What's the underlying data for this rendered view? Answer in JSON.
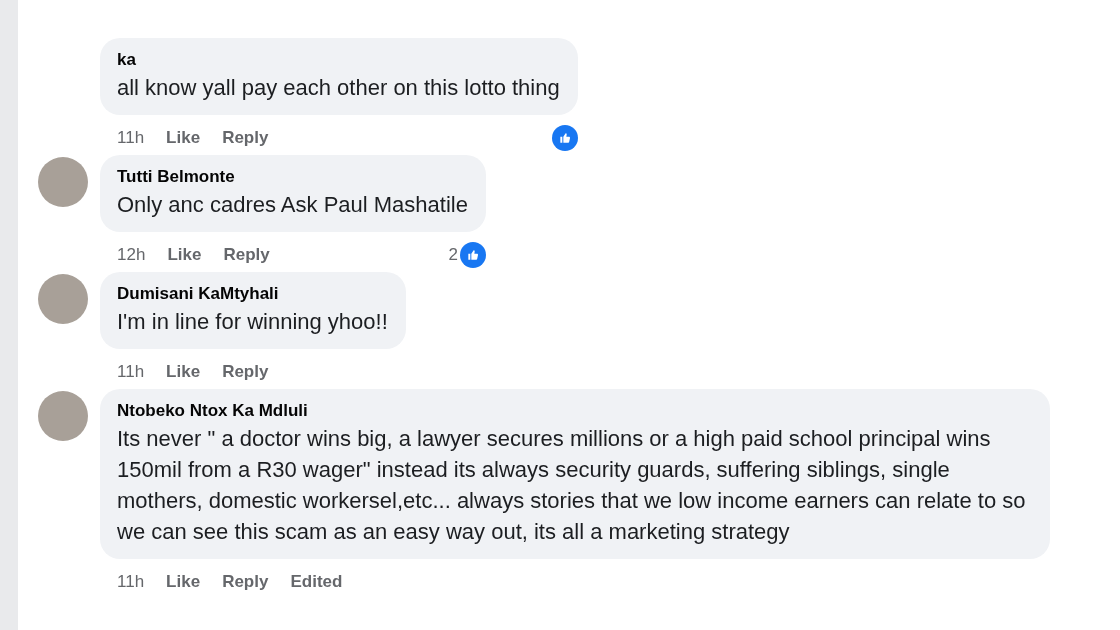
{
  "comments": [
    {
      "author": "ka",
      "avatar": false,
      "text": "all know yall pay each other on this lotto thing",
      "time": "11h",
      "actions": [
        "Like",
        "Reply"
      ],
      "edited": false,
      "liked": true
    },
    {
      "author": "Tutti Belmonte",
      "avatar": true,
      "text": "Only anc cadres Ask Paul Mashatile",
      "time": "12h",
      "actions": [
        "Like",
        "Reply"
      ],
      "edited": false,
      "liked": true,
      "like_count": "2"
    },
    {
      "author": "Dumisani KaMtyhali",
      "avatar": true,
      "text": "I'm in line for winning yhoo!!",
      "time": "11h",
      "actions": [
        "Like",
        "Reply"
      ],
      "edited": false,
      "liked": false
    },
    {
      "author": "Ntobeko Ntox Ka Mdluli",
      "avatar": true,
      "text": "Its never \" a doctor wins big, a lawyer secures millions or a high paid school principal wins 150mil from a R30 wager\" instead its always security guards, suffering siblings, single mothers, domestic workersel,etc... always stories that we low income earners can relate to so we can see this scam as an easy way out, its all a marketing strategy",
      "time": "11h",
      "actions": [
        "Like",
        "Reply"
      ],
      "edited": true,
      "edited_label": "Edited",
      "liked": false
    }
  ]
}
